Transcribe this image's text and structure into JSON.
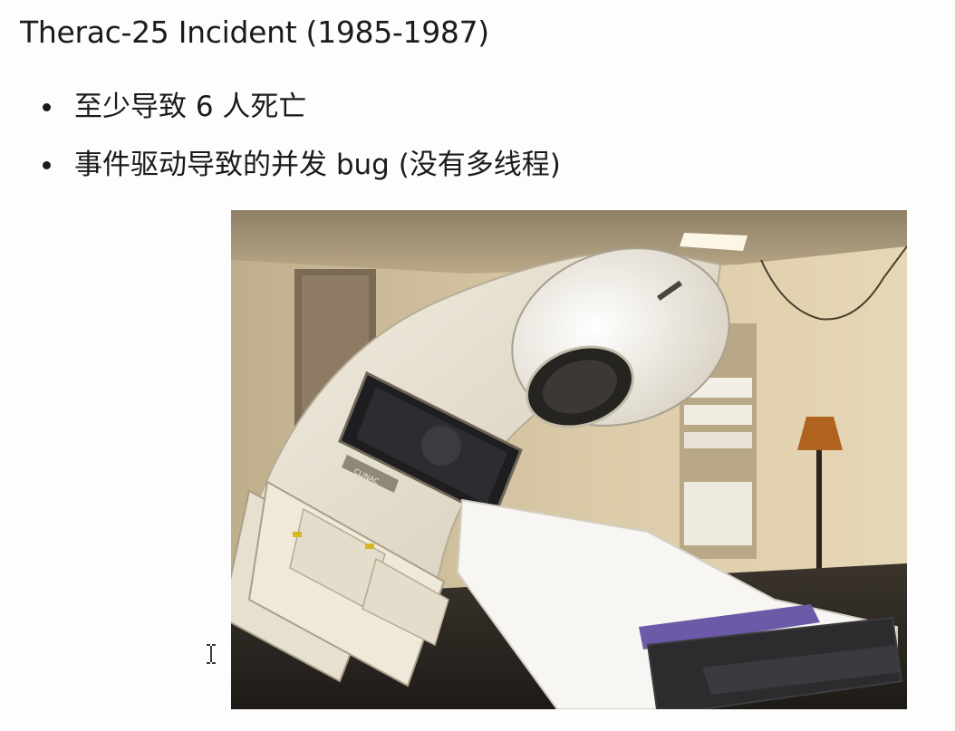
{
  "slide": {
    "title": "Therac-25 Incident (1985-1987)",
    "bullets": [
      {
        "text": "至少导致 6 人死亡"
      },
      {
        "text": "事件驱动导致的并发 bug (没有多线程)"
      }
    ]
  },
  "photo": {
    "label_on_console": "CLINAC"
  },
  "cursor": {
    "icon": "text-cursor-icon"
  },
  "colors": {
    "background": "#fdfdfd",
    "text": "#1b1b1b",
    "wall": "#d8c7a2",
    "machine": "#ede6d6",
    "sheet": "#f7f6f3",
    "table_pad": "#6c5aa8"
  }
}
